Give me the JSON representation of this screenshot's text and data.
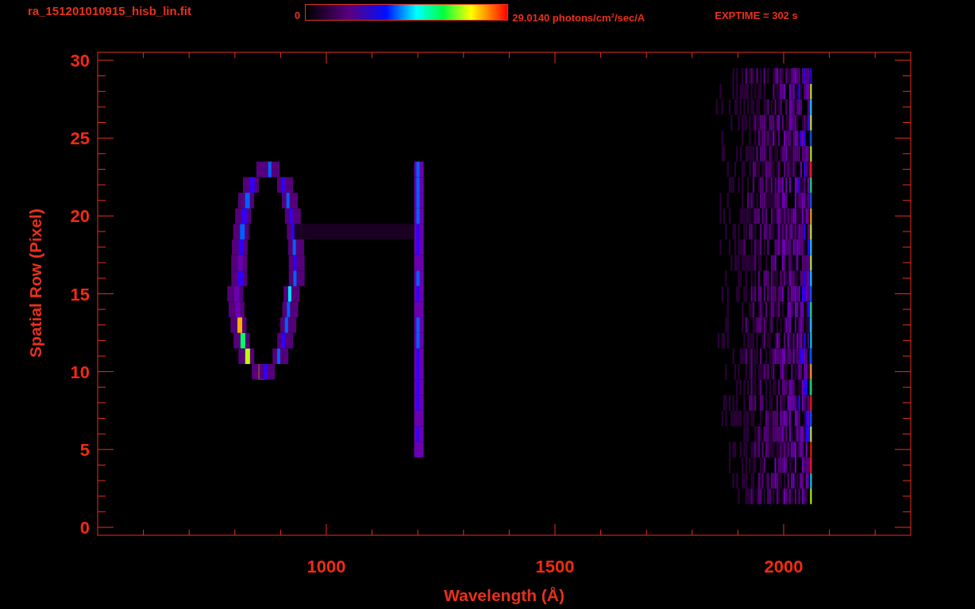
{
  "header": {
    "filename": "ra_151201010915_hisb_lin.fit",
    "colorbar_min": "0",
    "colorbar_max": "29.0140 photons/cm$^{2}$/sec/A",
    "exposure": "EXPTIME = 302 s"
  },
  "plot": {
    "y_axis": {
      "title": "Spatial Row (Pixel)",
      "ticks": [
        "30",
        "25",
        "20",
        "15",
        "10",
        "5",
        "0"
      ]
    },
    "x_axis": {
      "title": "Wavelength (Å)",
      "ticks": [
        "1000",
        "1500",
        "2000"
      ]
    }
  }
}
